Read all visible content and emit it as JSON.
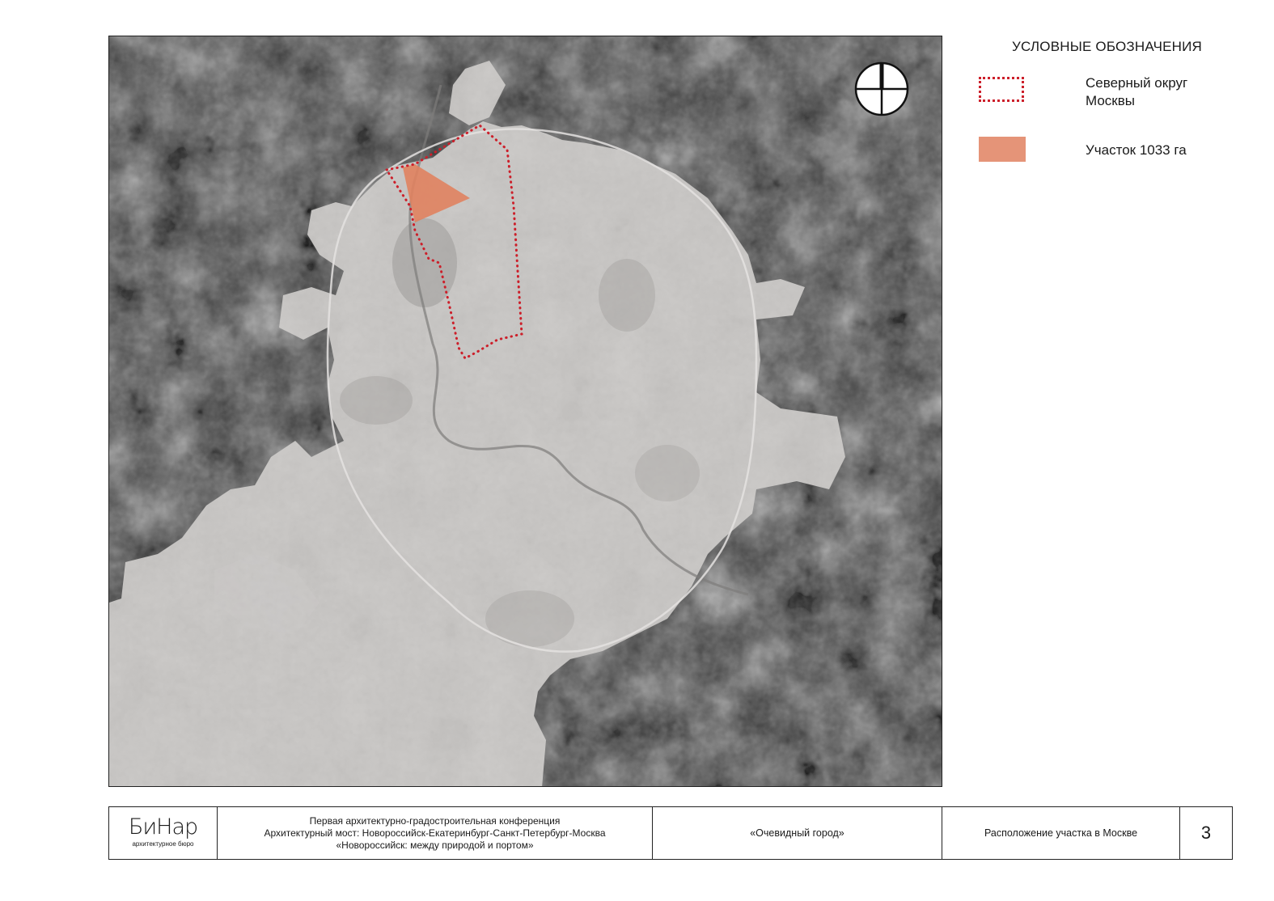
{
  "legend": {
    "title": "УСЛОВНЫЕ ОБОЗНАЧЕНИЯ",
    "items": [
      {
        "label_line1": "Северный округ",
        "label_line2": "Москвы",
        "symbol": "dotted-outline",
        "color": "#cc1f2a"
      },
      {
        "label_line1": "Участок 1033 га",
        "label_line2": "",
        "symbol": "filled-area",
        "color": "#e59478"
      }
    ]
  },
  "map": {
    "type": "satellite-aerial",
    "north_arrow": "north-arrow-icon",
    "colors": {
      "city_overlay": "#d2cfcd",
      "surroundings": "#4b4b4b",
      "district_outline": "#cc1f2a",
      "plot_fill": "#e0825f"
    }
  },
  "footer": {
    "logo_word": "БиНар",
    "logo_subtitle": "архитектурное бюро",
    "conference_line1": "Первая архитектурно-градостроительная конференция",
    "conference_line2": "Архитектурный мост: Новороссийск-Екатеринбург-Санкт-Петербург-Москва",
    "conference_line3": "«Новороссийск: между природой и портом»",
    "project": "«Очевидный город»",
    "sheet_title": "Расположение участка в Москве",
    "page_number": "3"
  }
}
